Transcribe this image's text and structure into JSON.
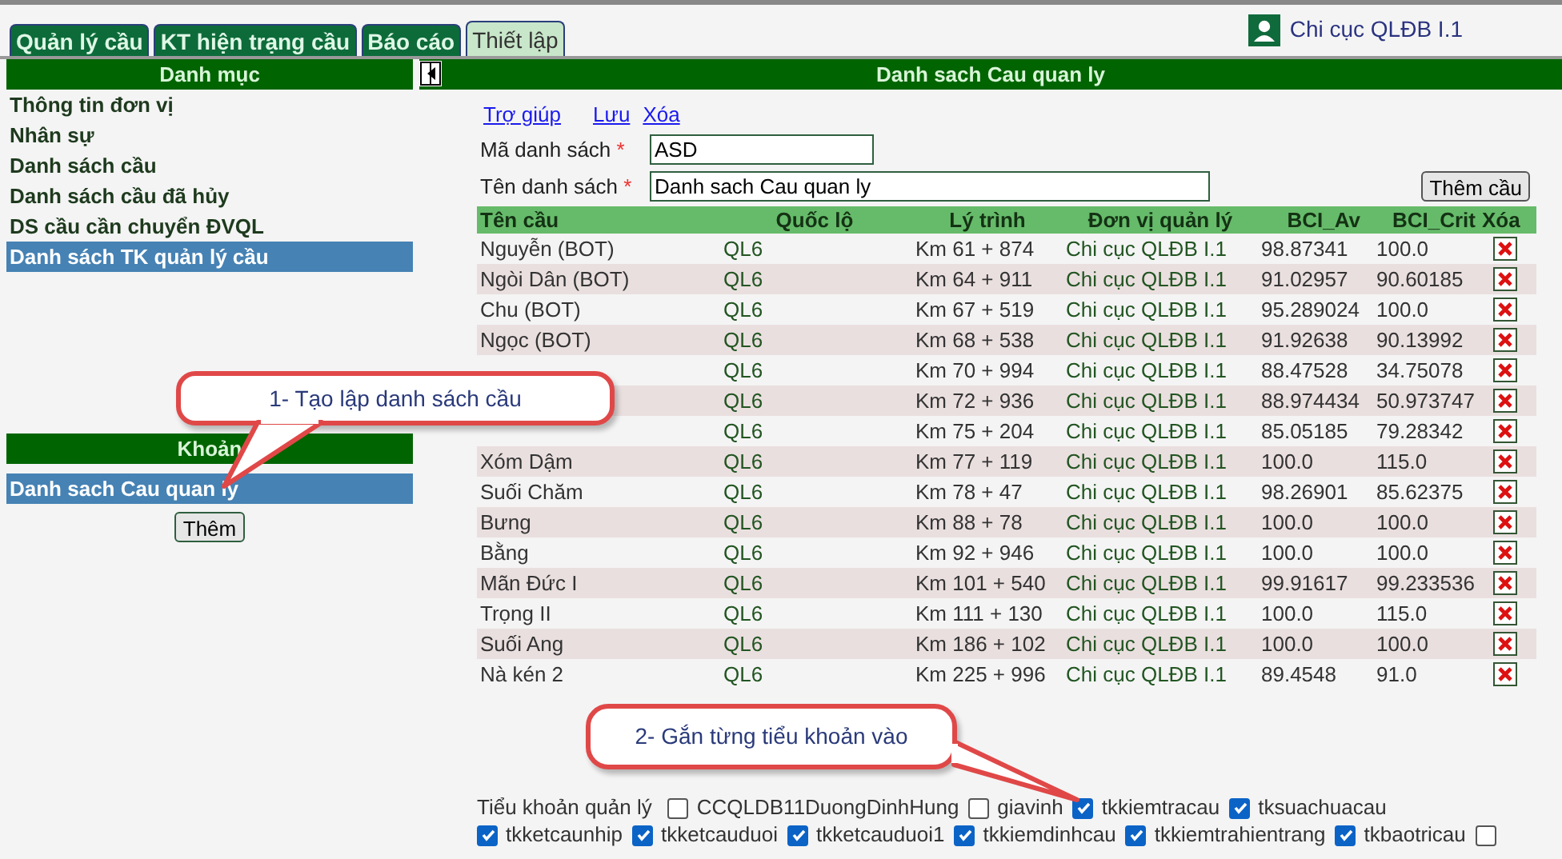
{
  "tabs": [
    {
      "label": "Quản lý cầu",
      "selected": false
    },
    {
      "label": "KT hiện trạng cầu",
      "selected": false
    },
    {
      "label": "Báo cáo",
      "selected": false
    },
    {
      "label": "Thiết lập",
      "selected": true
    }
  ],
  "user": {
    "name": "Chi cục QLĐB I.1"
  },
  "sidebar": {
    "title": "Danh mục",
    "items": [
      {
        "label": "Thông tin đơn vị",
        "selected": false
      },
      {
        "label": "Nhân sự",
        "selected": false
      },
      {
        "label": "Danh sách cầu",
        "selected": false
      },
      {
        "label": "Danh sách cầu đã hủy",
        "selected": false
      },
      {
        "label": "DS cầu cần chuyển ĐVQL",
        "selected": false
      },
      {
        "label": "Danh sách TK quản lý cầu",
        "selected": true
      }
    ],
    "section_title": "Khoản",
    "list_items": [
      {
        "label": "Danh sach Cau quan ly",
        "selected": true
      }
    ],
    "add_button": "Thêm"
  },
  "panel": {
    "title": "Danh sach Cau quan ly",
    "links": [
      "Trợ giúp",
      "Lưu",
      "Xóa"
    ],
    "fields": [
      {
        "label": "Mã danh sách",
        "required_mark": "*",
        "value": "ASD"
      },
      {
        "label": "Tên danh sách",
        "required_mark": "*",
        "value": "Danh sach Cau quan ly"
      }
    ],
    "add_button": "Thêm cầu",
    "table": {
      "columns": [
        "Tên cầu",
        "Quốc lộ",
        "Lý trình",
        "Đơn vị quản lý",
        "BCI_Av",
        "BCI_Crit",
        "Xóa"
      ],
      "rows": [
        {
          "name": "Nguyễn (BOT)",
          "road": "QL6",
          "km": "Km 61 + 874",
          "unit": "Chi cục QLĐB I.1",
          "av": "98.87341",
          "crit": "100.0"
        },
        {
          "name": "Ngòi Dân (BOT)",
          "road": "QL6",
          "km": "Km 64 + 911",
          "unit": "Chi cục QLĐB I.1",
          "av": "91.02957",
          "crit": "90.60185"
        },
        {
          "name": "Chu (BOT)",
          "road": "QL6",
          "km": "Km 67 + 519",
          "unit": "Chi cục QLĐB I.1",
          "av": "95.289024",
          "crit": "100.0"
        },
        {
          "name": "Ngọc (BOT)",
          "road": "QL6",
          "km": "Km 68 + 538",
          "unit": "Chi cục QLĐB I.1",
          "av": "91.92638",
          "crit": "90.13992"
        },
        {
          "road": "QL6",
          "km": "Km 70 + 994",
          "unit": "Chi cục QLĐB I.1",
          "av": "88.47528",
          "crit": "34.75078"
        },
        {
          "road": "QL6",
          "km": "Km 72 + 936",
          "unit": "Chi cục QLĐB I.1",
          "av": "88.974434",
          "crit": "50.973747"
        },
        {
          "road": "QL6",
          "km": "Km 75 + 204",
          "unit": "Chi cục QLĐB I.1",
          "av": "85.05185",
          "crit": "79.28342"
        },
        {
          "name": "Xóm Dậm",
          "road": "QL6",
          "km": "Km 77 + 119",
          "unit": "Chi cục QLĐB I.1",
          "av": "100.0",
          "crit": "115.0"
        },
        {
          "name": "Suối Chăm",
          "road": "QL6",
          "km": "Km 78 + 47",
          "unit": "Chi cục QLĐB I.1",
          "av": "98.26901",
          "crit": "85.62375"
        },
        {
          "name": "Bưng",
          "road": "QL6",
          "km": "Km 88 + 78",
          "unit": "Chi cục QLĐB I.1",
          "av": "100.0",
          "crit": "100.0"
        },
        {
          "name": "Bằng",
          "road": "QL6",
          "km": "Km 92 + 946",
          "unit": "Chi cục QLĐB I.1",
          "av": "100.0",
          "crit": "100.0"
        },
        {
          "name": "Mãn Đức I",
          "road": "QL6",
          "km": "Km 101 + 540",
          "unit": "Chi cục QLĐB I.1",
          "av": "99.91617",
          "crit": "99.233536"
        },
        {
          "name": "Trọng II",
          "road": "QL6",
          "km": "Km 111 + 130",
          "unit": "Chi cục QLĐB I.1",
          "av": "100.0",
          "crit": "115.0"
        },
        {
          "name": "Suối Ang",
          "road": "QL6",
          "km": "Km 186 + 102",
          "unit": "Chi cục QLĐB I.1",
          "av": "100.0",
          "crit": "100.0"
        },
        {
          "name": "Nà kén 2",
          "road": "QL6",
          "km": "Km 225 + 996",
          "unit": "Chi cục QLĐB I.1",
          "av": "89.4548",
          "crit": "91.0"
        }
      ]
    },
    "accounts_label": "Tiểu khoản quản lý",
    "accounts": [
      {
        "label": "CCQLDB11DuongDinhHung",
        "checked": false
      },
      {
        "label": "giavinh",
        "checked": false
      },
      {
        "label": "tkkiemtracau",
        "checked": true
      },
      {
        "label": "tksuachuacau",
        "checked": true
      },
      {
        "label": "tkketcaunhip",
        "checked": true
      },
      {
        "label": "tkketcauduoi",
        "checked": true
      },
      {
        "label": "tkketcauduoi1",
        "checked": true
      },
      {
        "label": "tkkiemdinhcau",
        "checked": true
      },
      {
        "label": "tkkiemtrahientrang",
        "checked": true
      },
      {
        "label": "tkbaotricau",
        "checked": true
      },
      {
        "checked": false
      }
    ]
  },
  "callouts": [
    {
      "text": "1- Tạo lập danh sách cầu"
    },
    {
      "text": "2- Gắn từng tiểu khoản vào"
    }
  ]
}
